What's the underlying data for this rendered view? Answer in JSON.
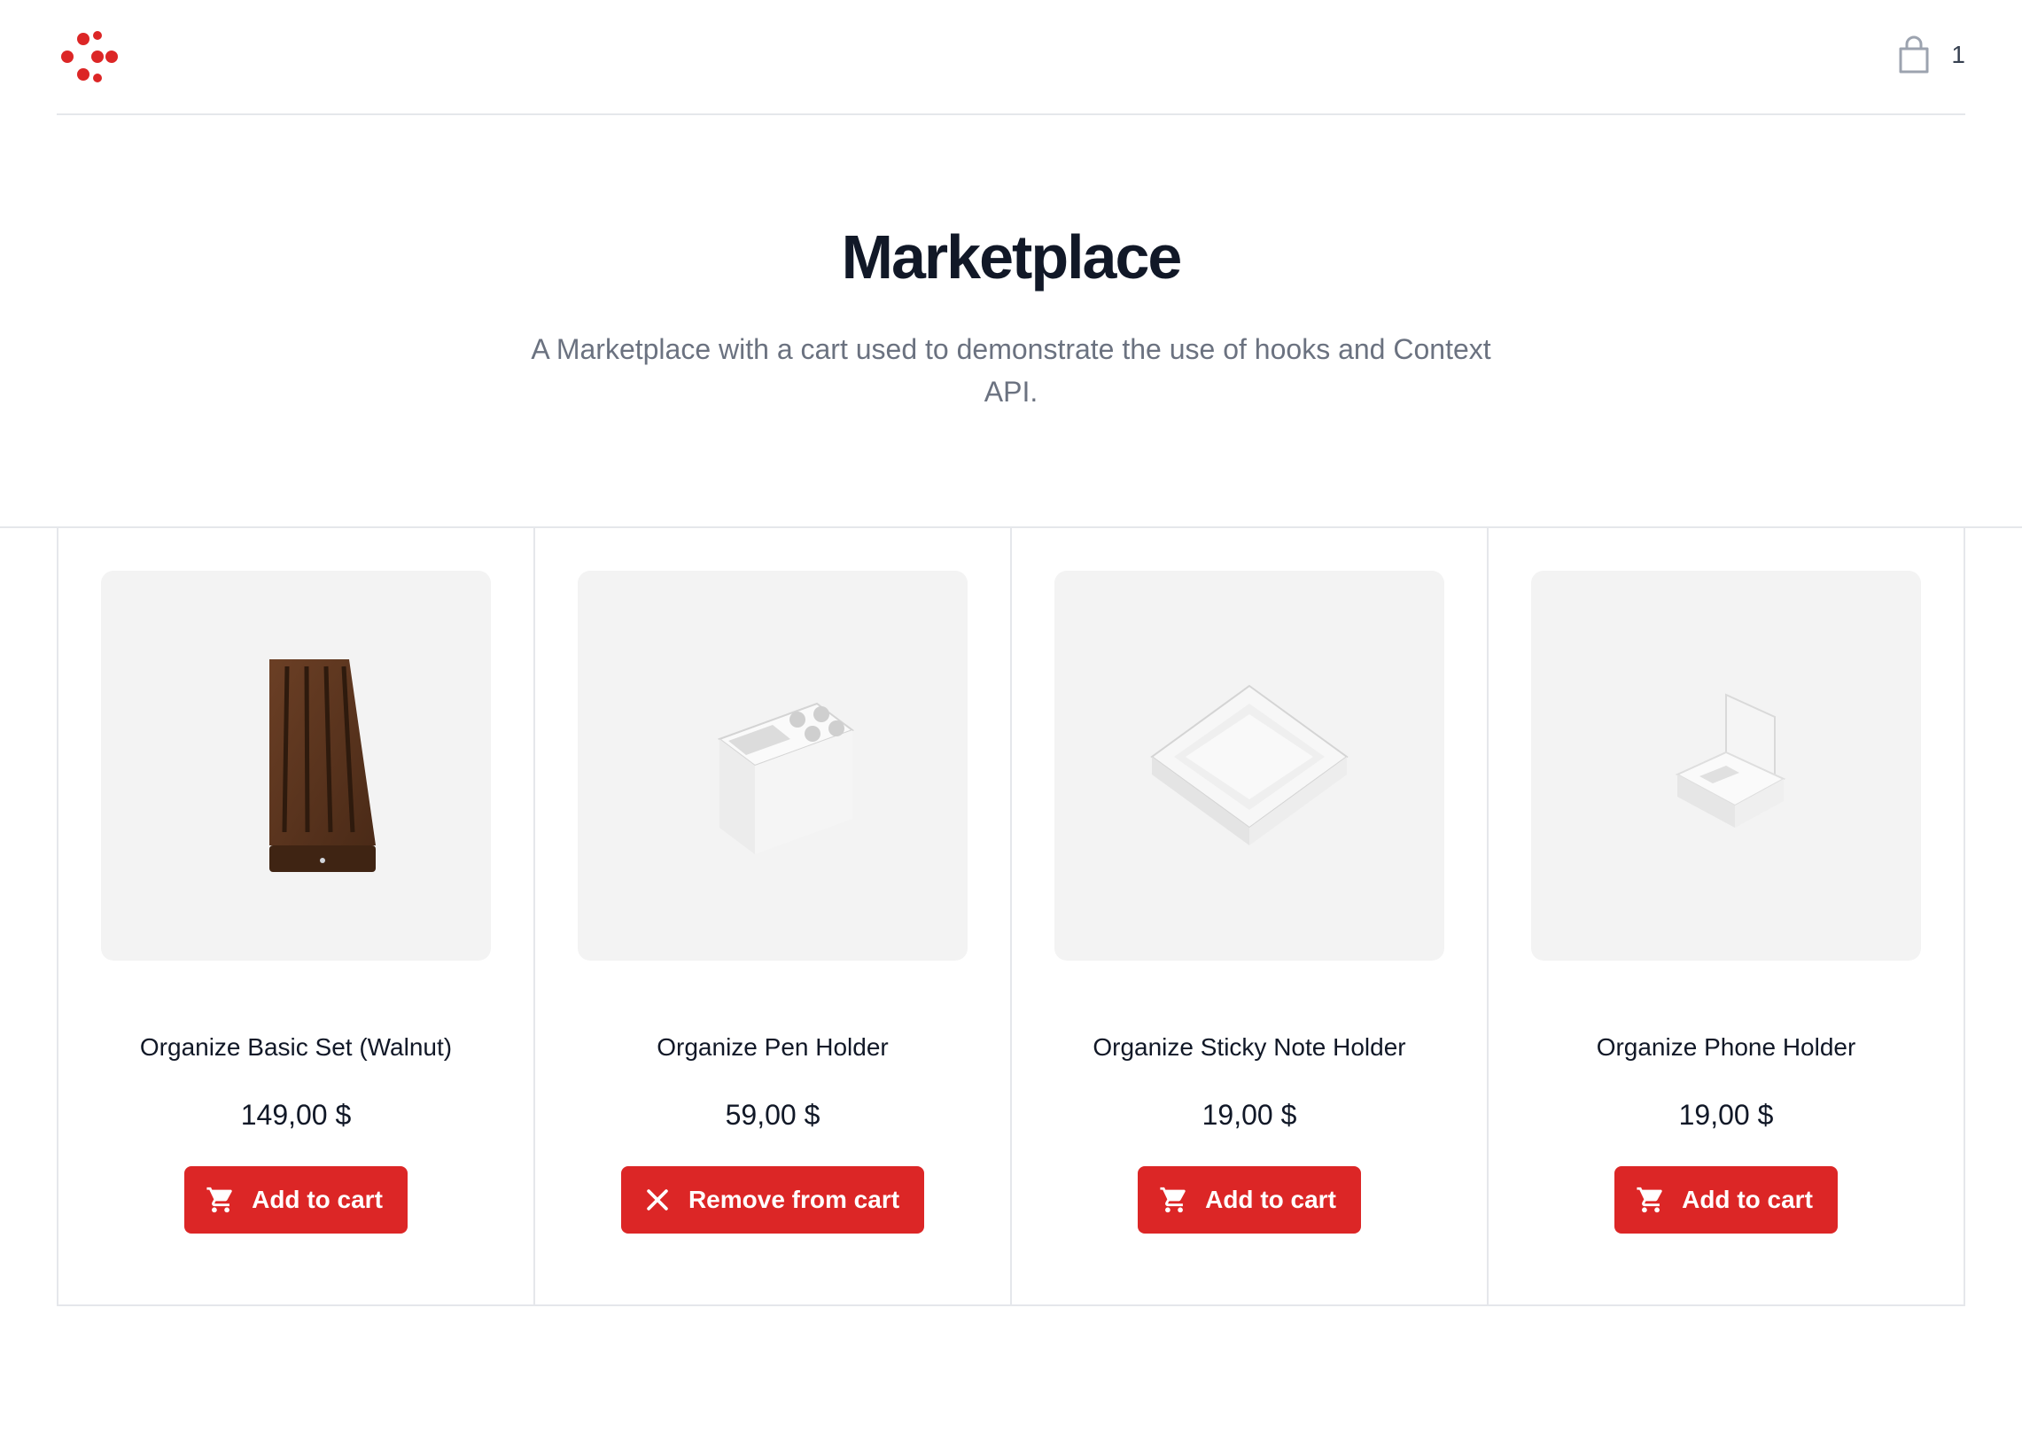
{
  "header": {
    "logo_icon": "red-dots-logo-icon",
    "cart_icon": "shopping-bag-icon",
    "cart_count": "1"
  },
  "hero": {
    "title": "Marketplace",
    "subtitle": "A Marketplace with a cart used to demonstrate the use of hooks and Context API."
  },
  "colors": {
    "accent": "#dc2626",
    "title": "#111827",
    "muted": "#6b7280",
    "border": "#e5e7eb",
    "thumb_bg": "#f3f3f3"
  },
  "products": [
    {
      "name": "Organize Basic Set (Walnut)",
      "price": "149,00 $",
      "button_label": "Add to cart",
      "button_icon": "cart-icon",
      "in_cart": false
    },
    {
      "name": "Organize Pen Holder",
      "price": "59,00 $",
      "button_label": "Remove from cart",
      "button_icon": "close-icon",
      "in_cart": true
    },
    {
      "name": "Organize Sticky Note Holder",
      "price": "19,00 $",
      "button_label": "Add to cart",
      "button_icon": "cart-icon",
      "in_cart": false
    },
    {
      "name": "Organize Phone Holder",
      "price": "19,00 $",
      "button_label": "Add to cart",
      "button_icon": "cart-icon",
      "in_cart": false
    }
  ]
}
